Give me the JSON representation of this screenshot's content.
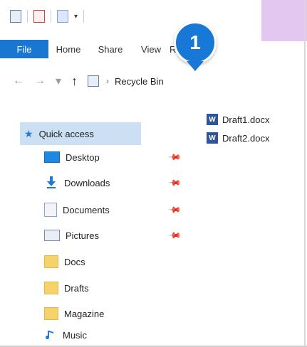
{
  "ribbon": {
    "tabs": [
      {
        "label": "File"
      },
      {
        "label": "Home"
      },
      {
        "label": "Share"
      },
      {
        "label": "View"
      },
      {
        "label": "Recycle Bin Tools (truncated)"
      }
    ],
    "truncated_tab_text": "Rec"
  },
  "address": {
    "location": "Recycle Bin",
    "nav_back": "←",
    "nav_forward": "→",
    "nav_recent": "▾",
    "nav_up": "↑",
    "separator": "›"
  },
  "callout": {
    "number": "1"
  },
  "sidebar": {
    "quick_access": "Quick access",
    "items": [
      {
        "label": "Desktop",
        "pinned": true
      },
      {
        "label": "Downloads",
        "pinned": true
      },
      {
        "label": "Documents",
        "pinned": true
      },
      {
        "label": "Pictures",
        "pinned": true
      },
      {
        "label": "Docs",
        "pinned": false
      },
      {
        "label": "Drafts",
        "pinned": false
      },
      {
        "label": "Magazine",
        "pinned": false
      },
      {
        "label": "Music",
        "pinned": false
      }
    ]
  },
  "files": [
    {
      "name": "Draft1.docx"
    },
    {
      "name": "Draft2.docx"
    }
  ],
  "colors": {
    "file_tab": "#1977d2",
    "selected_bg": "#ccdff3",
    "callout": "#1778d6",
    "context_band": "#e3c7f0"
  }
}
